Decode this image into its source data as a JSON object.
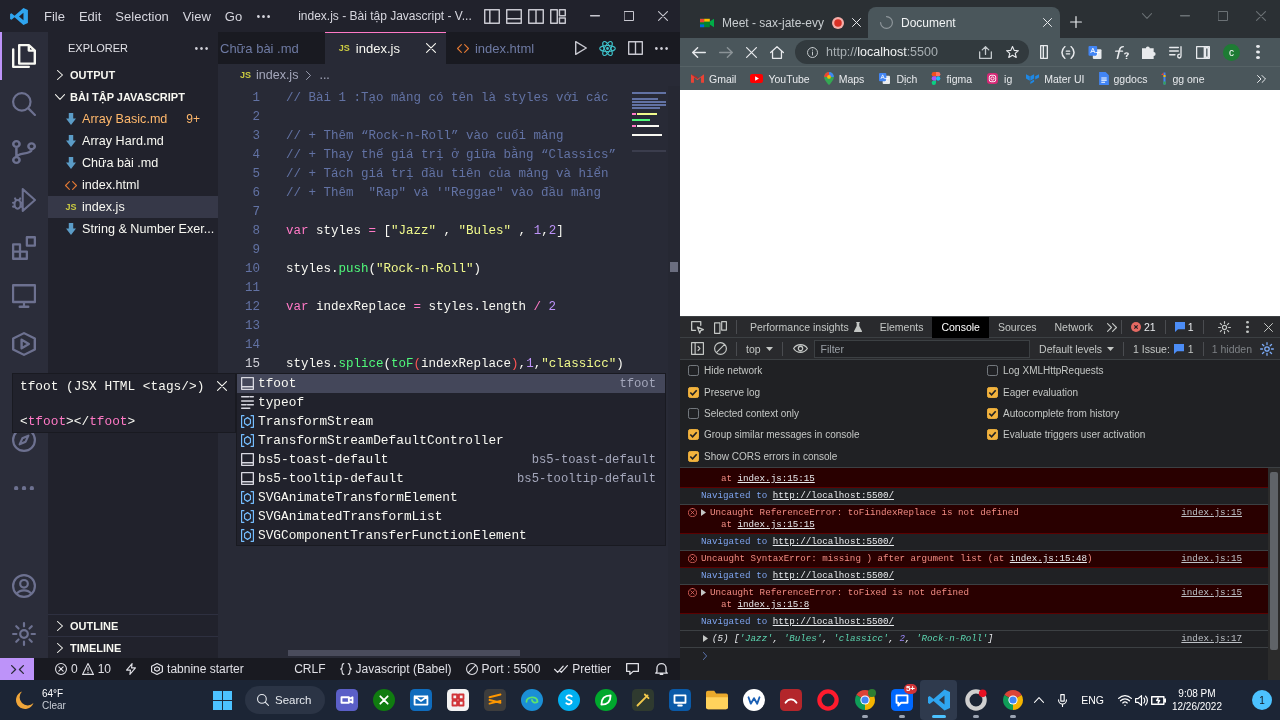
{
  "vscode": {
    "menu": [
      "File",
      "Edit",
      "Selection",
      "View",
      "Go"
    ],
    "title": "index.js - Bài tập Javascript - V...",
    "activity_bar": {
      "top": [
        {
          "kind": "explorer",
          "selected": true
        },
        {
          "kind": "search",
          "selected": false
        },
        {
          "kind": "source_control",
          "selected": false
        },
        {
          "kind": "run_debug",
          "selected": false
        },
        {
          "kind": "extensions",
          "selected": false
        },
        {
          "kind": "remote",
          "selected": false
        },
        {
          "kind": "deploy",
          "selected": false
        },
        {
          "kind": "compass",
          "selected": false
        },
        {
          "kind": "more",
          "selected": false
        }
      ],
      "bottom": [
        {
          "kind": "account"
        },
        {
          "kind": "settings"
        }
      ]
    },
    "sidebar": {
      "title": "EXPLORER",
      "sections": [
        {
          "label": "OUTPUT",
          "expanded": false
        },
        {
          "label": "BÀI TẬP JAVASCRIPT",
          "expanded": true,
          "files": [
            {
              "name": "Array Basic.md",
              "kind": "md",
              "has_problems": true,
              "badge": "9+",
              "selected": false
            },
            {
              "name": "Array Hard.md",
              "kind": "md",
              "has_problems": false,
              "selected": false
            },
            {
              "name": "Chữa bài .md",
              "kind": "md",
              "has_problems": false,
              "selected": false
            },
            {
              "name": "index.html",
              "kind": "html",
              "has_problems": false,
              "selected": false
            },
            {
              "name": "index.js",
              "kind": "js",
              "icon_label": "JS",
              "has_problems": false,
              "selected": true
            },
            {
              "name": "String & Number Exer...",
              "kind": "md",
              "has_problems": false,
              "selected": false
            }
          ]
        }
      ],
      "footer_sections": [
        {
          "label": "OUTLINE",
          "expanded": false
        },
        {
          "label": "TIMELINE",
          "expanded": false
        }
      ]
    },
    "editor": {
      "tabs": [
        {
          "label": "Chữa bài .md",
          "kind": "md",
          "selected": false
        },
        {
          "label": "index.js",
          "kind": "js",
          "icon_label": "JS",
          "selected": true
        },
        {
          "label": "index.html",
          "kind": "html",
          "selected": false
        }
      ],
      "breadcrumb": {
        "icon_label": "JS",
        "file": "index.js",
        "rest": "..."
      },
      "lines": [
        {
          "number": "1",
          "active": false,
          "tokens": [
            {
              "kind": "comment",
              "text": "// Bài 1 :Tạo mảng có tên là styles với các"
            }
          ]
        },
        {
          "number": "2",
          "active": false
        },
        {
          "number": "3",
          "active": false,
          "tokens": [
            {
              "kind": "comment",
              "text": "// + Thêm “Rock-n-Roll” vào cuối mảng"
            }
          ]
        },
        {
          "number": "4",
          "active": false,
          "tokens": [
            {
              "kind": "comment",
              "text": "// + Thay thế giá trị ở giữa bằng “Classics”"
            }
          ]
        },
        {
          "number": "5",
          "active": false,
          "tokens": [
            {
              "kind": "comment",
              "text": "// + Tách giá trị đầu tiên của mảng và hiển"
            }
          ]
        },
        {
          "number": "6",
          "active": false,
          "tokens": [
            {
              "kind": "comment",
              "text": "// + Thêm  \"Rap\" và '\"Reggae\" vào đầu mảng"
            }
          ]
        },
        {
          "number": "7",
          "active": false
        },
        {
          "number": "8",
          "active": false,
          "tokens": [
            {
              "kind": "keyword",
              "text": "var"
            },
            {
              "kind": "plain",
              "text": " styles "
            },
            {
              "kind": "operator",
              "text": "="
            },
            {
              "kind": "plain",
              "text": " ["
            },
            {
              "kind": "string",
              "text": "\"Jazz\""
            },
            {
              "kind": "plain",
              "text": " , "
            },
            {
              "kind": "string",
              "text": "\"Bules\""
            },
            {
              "kind": "plain",
              "text": " , "
            },
            {
              "kind": "number",
              "text": "1"
            },
            {
              "kind": "plain",
              "text": ","
            },
            {
              "kind": "number",
              "text": "2"
            },
            {
              "kind": "plain",
              "text": "]"
            }
          ]
        },
        {
          "number": "9",
          "active": false
        },
        {
          "number": "10",
          "active": false,
          "tokens": [
            {
              "kind": "plain",
              "text": "styles."
            },
            {
              "kind": "function",
              "text": "push"
            },
            {
              "kind": "plain",
              "text": "("
            },
            {
              "kind": "string",
              "text": "\"Rock-n-Roll\""
            },
            {
              "kind": "plain",
              "text": ")"
            }
          ]
        },
        {
          "number": "11",
          "active": false
        },
        {
          "number": "12",
          "active": false,
          "tokens": [
            {
              "kind": "keyword",
              "text": "var"
            },
            {
              "kind": "plain",
              "text": " indexReplace "
            },
            {
              "kind": "operator",
              "text": "="
            },
            {
              "kind": "plain",
              "text": " styles.length "
            },
            {
              "kind": "operator",
              "text": "/"
            },
            {
              "kind": "number",
              "text": " 2"
            }
          ]
        },
        {
          "number": "13",
          "active": false
        },
        {
          "number": "14",
          "active": false
        },
        {
          "number": "15",
          "active": true,
          "tokens": [
            {
              "kind": "plain",
              "text": "styles."
            },
            {
              "kind": "function",
              "text": "splice"
            },
            {
              "kind": "plain",
              "text": "("
            },
            {
              "kind": "function",
              "text": "toF"
            },
            {
              "kind": "bracket_error",
              "text": "("
            },
            {
              "kind": "plain",
              "text": "indexReplace"
            },
            {
              "kind": "bracket_error",
              "text": ")"
            },
            {
              "kind": "plain",
              "text": ","
            },
            {
              "kind": "number",
              "text": "1"
            },
            {
              "kind": "plain",
              "text": ","
            },
            {
              "kind": "string",
              "text": "\"classicc\""
            },
            {
              "kind": "plain",
              "text": ")"
            }
          ]
        }
      ],
      "suggestions": [
        {
          "label": "tfoot",
          "kind": "snippet",
          "detail": "tfoot",
          "selected": true
        },
        {
          "label": "typeof",
          "kind": "keyword",
          "selected": false
        },
        {
          "label": "TransformStream",
          "kind": "variable",
          "selected": false
        },
        {
          "label": "TransformStreamDefaultController",
          "kind": "variable",
          "selected": false
        },
        {
          "label": "bs5-toast-default",
          "kind": "snippet",
          "detail": "bs5-toast-default",
          "selected": false
        },
        {
          "label": "bs5-tooltip-default",
          "kind": "snippet",
          "detail": "bs5-tooltip-default",
          "selected": false
        },
        {
          "label": "SVGAnimateTransformElement",
          "kind": "variable",
          "selected": false
        },
        {
          "label": "SVGAnimatedTransformList",
          "kind": "variable",
          "selected": false
        },
        {
          "label": "SVGComponentTransferFunctionElement",
          "kind": "variable",
          "selected": false
        }
      ],
      "suggestion_detail": {
        "title": "tfoot (JSX HTML <tags/>)",
        "code": [
          {
            "kind": "punct",
            "text": "<"
          },
          {
            "kind": "tag",
            "text": "tfoot"
          },
          {
            "kind": "punct",
            "text": "></"
          },
          {
            "kind": "tag",
            "text": "tfoot"
          },
          {
            "kind": "punct",
            "text": ">"
          }
        ]
      }
    },
    "status_bar": {
      "errors": "0",
      "warnings": "10",
      "extension": "tabnine starter",
      "eol": "CRLF",
      "language": "Javascript (Babel)",
      "port": "Port : 5500",
      "formatter": "Prettier"
    }
  },
  "browser": {
    "tabs": [
      {
        "title": "Meet - sax-jate-evy",
        "kind": "video_camera",
        "recording": true,
        "selected": false
      },
      {
        "title": "Document",
        "kind": "loading",
        "recording": false,
        "selected": true
      }
    ],
    "forward_enabled": false,
    "loading": true,
    "url": {
      "scheme": "http://",
      "host": "localhost",
      "port": ":5500"
    },
    "profile_initial": "c",
    "bookmarks": [
      {
        "label": "Gmail",
        "kind": "envelope"
      },
      {
        "label": "YouTube",
        "kind": "play_button"
      },
      {
        "label": "Maps",
        "kind": "map_pin"
      },
      {
        "label": "Dịch",
        "kind": "translate"
      },
      {
        "label": "figma",
        "kind": "stacked_shapes"
      },
      {
        "label": "ig",
        "kind": "camera"
      },
      {
        "label": "Mater UI",
        "kind": "zigzag_blocks"
      },
      {
        "label": "ggdocs",
        "kind": "document"
      },
      {
        "label": "gg one",
        "kind": "vertical_bar"
      }
    ],
    "devtools": {
      "tabs": [
        {
          "label": "Performance insights",
          "kind": "experimental",
          "selected": false
        },
        {
          "label": "Elements",
          "kind": "panel",
          "selected": false
        },
        {
          "label": "Console",
          "kind": "panel",
          "selected": true
        },
        {
          "label": "Sources",
          "kind": "panel",
          "selected": false
        },
        {
          "label": "Network",
          "kind": "panel",
          "selected": false
        }
      ],
      "error_count": "21",
      "message_count": "1",
      "context": "top",
      "filter_placeholder": "Filter",
      "levels": "Default levels",
      "issues_label": "1 Issue:",
      "issues_count": "1",
      "hidden_count": "1 hidden",
      "settings_open": true,
      "settings": [
        {
          "label": "Hide network",
          "checked": false
        },
        {
          "label": "Log XMLHttpRequests",
          "checked": false
        },
        {
          "label": "Preserve log",
          "checked": true
        },
        {
          "label": "Eager evaluation",
          "checked": true
        },
        {
          "label": "Selected context only",
          "checked": false
        },
        {
          "label": "Autocomplete from history",
          "checked": true
        },
        {
          "label": "Group similar messages in console",
          "checked": true
        },
        {
          "label": "Evaluate triggers user activation",
          "checked": true
        },
        {
          "label": "Show CORS errors in console",
          "checked": true
        }
      ],
      "messages": [
        {
          "kind": "error",
          "trace_prefix": "at",
          "trace_link": "index.js:15:15"
        },
        {
          "kind": "navigation",
          "expandable": false,
          "text": "Navigated to",
          "url": "http://localhost:5500/"
        },
        {
          "kind": "error",
          "expandable": true,
          "text": "Uncaught ReferenceError: toFiindexReplace is not defined",
          "trace_prefix": "at",
          "trace_link": "index.js:15:15",
          "source": "index.js:15"
        },
        {
          "kind": "navigation",
          "expandable": false,
          "text": "Navigated to",
          "url": "http://localhost:5500/"
        },
        {
          "kind": "error",
          "expandable": false,
          "text": "Uncaught SyntaxError: missing ) after argument list (at",
          "link": "index.js:15:48",
          "text_end": ")",
          "source": "index.js:15"
        },
        {
          "kind": "navigation",
          "expandable": false,
          "text": "Navigated to",
          "url": "http://localhost:5500/"
        },
        {
          "kind": "error",
          "expandable": true,
          "text": "Uncaught ReferenceError: toFixed is not defined",
          "trace_prefix": "at",
          "trace_link": "index.js:15:8",
          "source": "index.js:15"
        },
        {
          "kind": "navigation",
          "expandable": false,
          "text": "Navigated to",
          "url": "http://localhost:5500/"
        },
        {
          "kind": "log",
          "expandable": true,
          "count": "(5)",
          "tokens": [
            {
              "kind": "punct",
              "text": "["
            },
            {
              "kind": "string",
              "text": "'Jazz'"
            },
            {
              "kind": "punct",
              "text": ", "
            },
            {
              "kind": "string",
              "text": "'Bules'"
            },
            {
              "kind": "punct",
              "text": ", "
            },
            {
              "kind": "string",
              "text": "'classicc'"
            },
            {
              "kind": "punct",
              "text": ", "
            },
            {
              "kind": "number",
              "text": "2"
            },
            {
              "kind": "punct",
              "text": ", "
            },
            {
              "kind": "string",
              "text": "'Rock-n-Roll'"
            },
            {
              "kind": "punct",
              "text": "]"
            }
          ],
          "source": "index.js:17"
        }
      ]
    }
  },
  "taskbar": {
    "weather": {
      "temperature": "64°F",
      "condition": "Clear"
    },
    "search": "Search",
    "apps": [
      {
        "kind": "camera_tile",
        "running": false,
        "active": false
      },
      {
        "kind": "x_disc",
        "running": false,
        "active": false
      },
      {
        "kind": "mail",
        "running": false,
        "active": false
      },
      {
        "kind": "grid_tiles",
        "running": false,
        "active": false
      },
      {
        "kind": "striped_tile",
        "running": false,
        "active": false
      },
      {
        "kind": "wave_disc",
        "running": false,
        "active": false
      },
      {
        "kind": "swirl_disc",
        "running": false,
        "active": false
      },
      {
        "kind": "leaf_disc",
        "running": false,
        "active": false
      },
      {
        "kind": "pen_tile",
        "running": false,
        "active": false
      },
      {
        "kind": "monitor_tile",
        "running": false,
        "active": false
      },
      {
        "kind": "folder",
        "running": false,
        "active": false
      },
      {
        "kind": "zigzag_disc",
        "running": false,
        "active": false
      },
      {
        "kind": "arc_tile",
        "running": false,
        "active": false
      },
      {
        "kind": "ring",
        "running": false,
        "active": false
      },
      {
        "kind": "segmented_circle_dot",
        "running": true,
        "active": false
      },
      {
        "kind": "speech_bubble",
        "badge": "5+",
        "running": true,
        "active": false
      },
      {
        "kind": "ribbon",
        "running": true,
        "active": true
      },
      {
        "kind": "ring_dot",
        "running": true,
        "active": false
      },
      {
        "kind": "segmented_circle",
        "running": true,
        "active": false
      }
    ],
    "language": "ENG",
    "time": "9:08 PM",
    "date": "12/26/2022",
    "notification_count": "1"
  }
}
